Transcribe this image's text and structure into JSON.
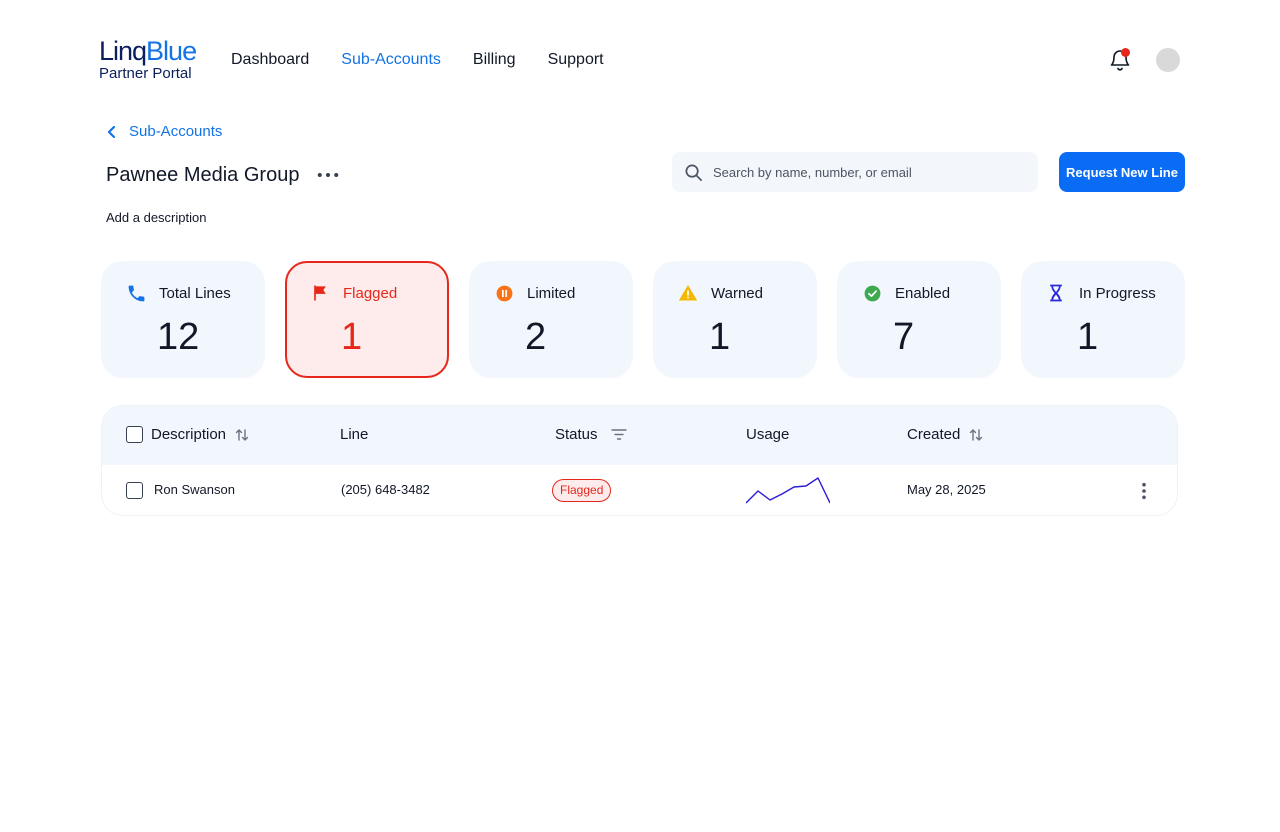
{
  "brand": {
    "name_part1": "Linq",
    "name_part2": "Blue",
    "subtitle": "Partner Portal"
  },
  "nav": [
    {
      "label": "Dashboard",
      "active": false
    },
    {
      "label": "Sub-Accounts",
      "active": true
    },
    {
      "label": "Billing",
      "active": false
    },
    {
      "label": "Support",
      "active": false
    }
  ],
  "header": {
    "notification_dot": true
  },
  "breadcrumb": {
    "label": "Sub-Accounts"
  },
  "page": {
    "title": "Pawnee Media Group",
    "description": "Add a description"
  },
  "search": {
    "placeholder": "Search by name, number, or email"
  },
  "actions": {
    "request_label": "Request New Line"
  },
  "stats": [
    {
      "label": "Total Lines",
      "value": "12",
      "icon": "phone-icon"
    },
    {
      "label": "Flagged",
      "value": "1",
      "icon": "flag-icon"
    },
    {
      "label": "Limited",
      "value": "2",
      "icon": "pause-circle-icon"
    },
    {
      "label": "Warned",
      "value": "1",
      "icon": "warning-icon"
    },
    {
      "label": "Enabled",
      "value": "7",
      "icon": "check-circle-icon"
    },
    {
      "label": "In Progress",
      "value": "1",
      "icon": "hourglass-icon"
    }
  ],
  "table": {
    "columns": {
      "description": "Description",
      "line": "Line",
      "status": "Status",
      "usage": "Usage",
      "created": "Created"
    },
    "rows": [
      {
        "description": "Ron Swanson",
        "line": "(205) 648-3482",
        "status": "Flagged",
        "created": "May 28, 2025",
        "usage": [
          2,
          14,
          5,
          11,
          18,
          19,
          27,
          2
        ]
      }
    ]
  },
  "colors": {
    "accent": "#1473e6",
    "primary_button": "#0a6cf5",
    "flagged": "#e8271b",
    "limited": "#f97316",
    "warned": "#f5b800",
    "enabled": "#3daa4f",
    "in_progress": "#2b2bd8",
    "card_bg": "#f2f6fd"
  }
}
